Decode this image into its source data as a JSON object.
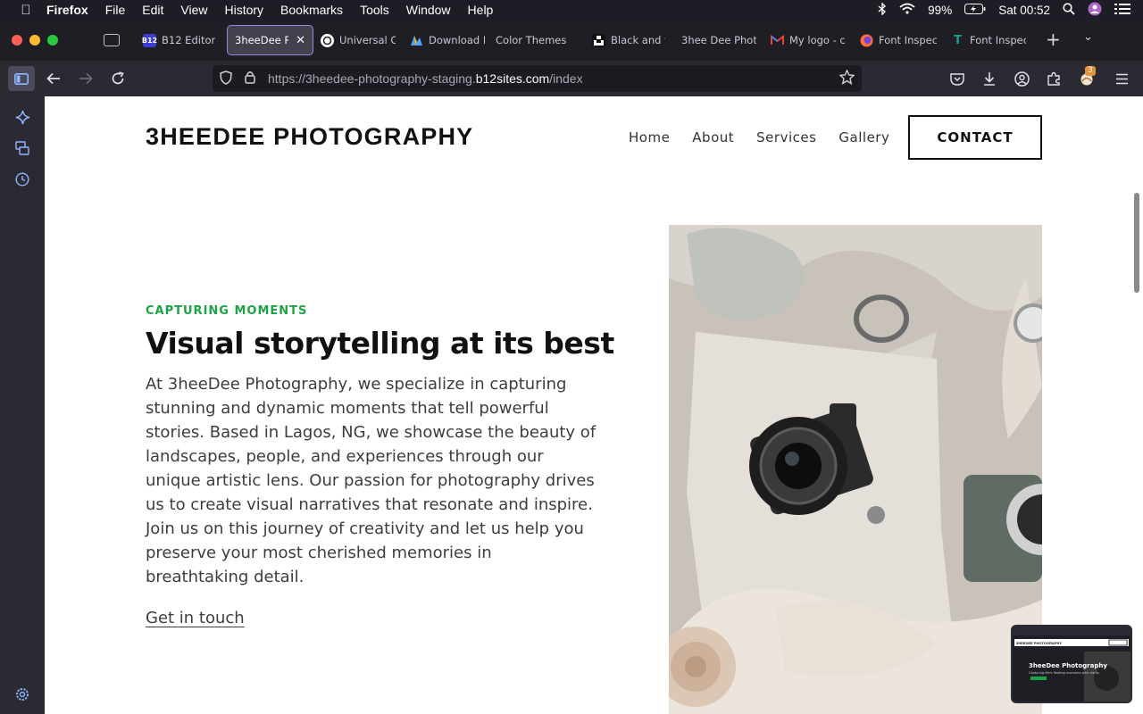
{
  "menubar": {
    "apple_icon": "apple-logo-icon",
    "items": [
      "Firefox",
      "File",
      "Edit",
      "View",
      "History",
      "Bookmarks",
      "Tools",
      "Window",
      "Help"
    ],
    "battery": "99%",
    "clock": "Sat 00:52"
  },
  "tabs": [
    {
      "title": "B12 Editor",
      "favicon_text": "B12",
      "favicon_color": "#3b3fd1",
      "active": false
    },
    {
      "title": "3heeDee Ph",
      "favicon_text": "",
      "favicon_color": "",
      "active": true
    },
    {
      "title": "Universal C",
      "favicon_text": "",
      "favicon_color": "#ffffff",
      "active": false
    },
    {
      "title": "Download F",
      "favicon_text": "",
      "favicon_color": "#4fa0ff",
      "active": false
    },
    {
      "title": "Color Themes",
      "favicon_text": "",
      "favicon_color": "",
      "active": false
    },
    {
      "title": "Black and w",
      "favicon_text": "",
      "favicon_color": "#000000",
      "active": false
    },
    {
      "title": "3hee Dee Phot",
      "favicon_text": "",
      "favicon_color": "",
      "active": false
    },
    {
      "title": "My logo - c",
      "favicon_text": "M",
      "favicon_color": "#ea4335",
      "active": false
    },
    {
      "title": "Font Inspec",
      "favicon_text": "",
      "favicon_color": "#ff7139",
      "active": false
    },
    {
      "title": "Font Inspec",
      "favicon_text": "T",
      "favicon_color": "#1a9e8f",
      "active": false
    }
  ],
  "toolbar": {
    "url_prefix": "https://3heedee-photography-staging.",
    "url_host": "b12sites.com",
    "url_path": "/index",
    "extension_badge": "3"
  },
  "site": {
    "logo": "3HEEDEE PHOTOGRAPHY",
    "nav": [
      "Home",
      "About",
      "Services",
      "Gallery"
    ],
    "contact_label": "CONTACT",
    "eyebrow": "CAPTURING MOMENTS",
    "headline": "Visual storytelling at its best",
    "body": "At 3heeDee Photography, we specialize in capturing stunning and dynamic moments that tell powerful stories. Based in Lagos, NG, we showcase the beauty of landscapes, people, and experiences through our unique artistic lens. Our passion for photography drives us to create visual narratives that resonate and inspire. Join us on this journey of creativity and let us help you preserve your most cherished memories in breathtaking detail.",
    "cta": "Get in touch",
    "accent_color": "#1da345"
  },
  "pip": {
    "logo": "3HEEDEE PHOTOGRAPHY",
    "title": "3heeDee Photography",
    "subtitle": "Capturing life's fleeting moments with clarity"
  }
}
